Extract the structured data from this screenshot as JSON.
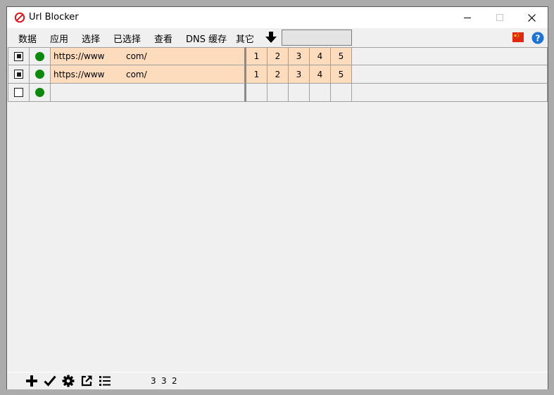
{
  "window": {
    "title": "Url Blocker"
  },
  "menu": [
    "数据",
    "应用",
    "选择",
    "已选择",
    "查看",
    "DNS 缓存",
    "其它"
  ],
  "menu_search": {
    "value": "",
    "placeholder": ""
  },
  "columns": [
    "1",
    "2",
    "3",
    "4",
    "5"
  ],
  "rows": [
    {
      "checked": true,
      "url": "https://www        com/",
      "active": true,
      "nums": [
        "1",
        "2",
        "3",
        "4",
        "5"
      ]
    },
    {
      "checked": true,
      "url": "https://www        com/",
      "active": true,
      "nums": [
        "1",
        "2",
        "3",
        "4",
        "5"
      ]
    },
    {
      "checked": false,
      "url": "",
      "active": true,
      "nums": [
        "",
        "",
        "",
        "",
        ""
      ]
    }
  ],
  "status": {
    "values": [
      "3",
      "3",
      "2"
    ]
  },
  "icons": {
    "app": "no-entry-icon",
    "download": "arrow-down-icon",
    "flag": "china-flag-icon",
    "help": "help-icon",
    "toolbar": [
      "plus-icon",
      "check-icon",
      "gear-icon",
      "external-link-icon",
      "list-icon"
    ]
  },
  "colors": {
    "row_fill": "#fddcbd",
    "status_green": "#0c880c",
    "app_icon_red": "#d8191e",
    "help_blue": "#1e73d2"
  }
}
